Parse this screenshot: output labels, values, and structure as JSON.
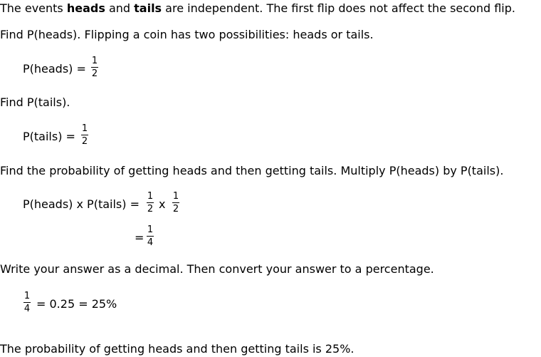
{
  "intro": {
    "pre": "The events ",
    "heads": "heads",
    "and": " and ",
    "tails": "tails",
    "post": " are independent. The first flip does not affect the second flip."
  },
  "step1": {
    "text": "Find P(heads). Flipping a coin has two possibilities: heads or tails.",
    "lhs": "P(heads)",
    "eq": "=",
    "num": "1",
    "den": "2"
  },
  "step2": {
    "text": "Find P(tails).",
    "lhs": "P(tails)",
    "eq": "=",
    "num": "1",
    "den": "2"
  },
  "step3": {
    "text": "Find the probability of getting heads and then getting tails. Multiply P(heads) by P(tails).",
    "lhs": "P(heads) x P(tails)",
    "eq": "=",
    "f1_num": "1",
    "f1_den": "2",
    "times": "x",
    "f2_num": "1",
    "f2_den": "2",
    "eq2": "=",
    "r_num": "1",
    "r_den": "4"
  },
  "step4": {
    "text": "Write your answer as a decimal. Then convert your answer to a percentage.",
    "num": "1",
    "den": "4",
    "rest": "= 0.25 = 25%"
  },
  "conclusion": "The probability of getting heads and then getting tails is 25%."
}
